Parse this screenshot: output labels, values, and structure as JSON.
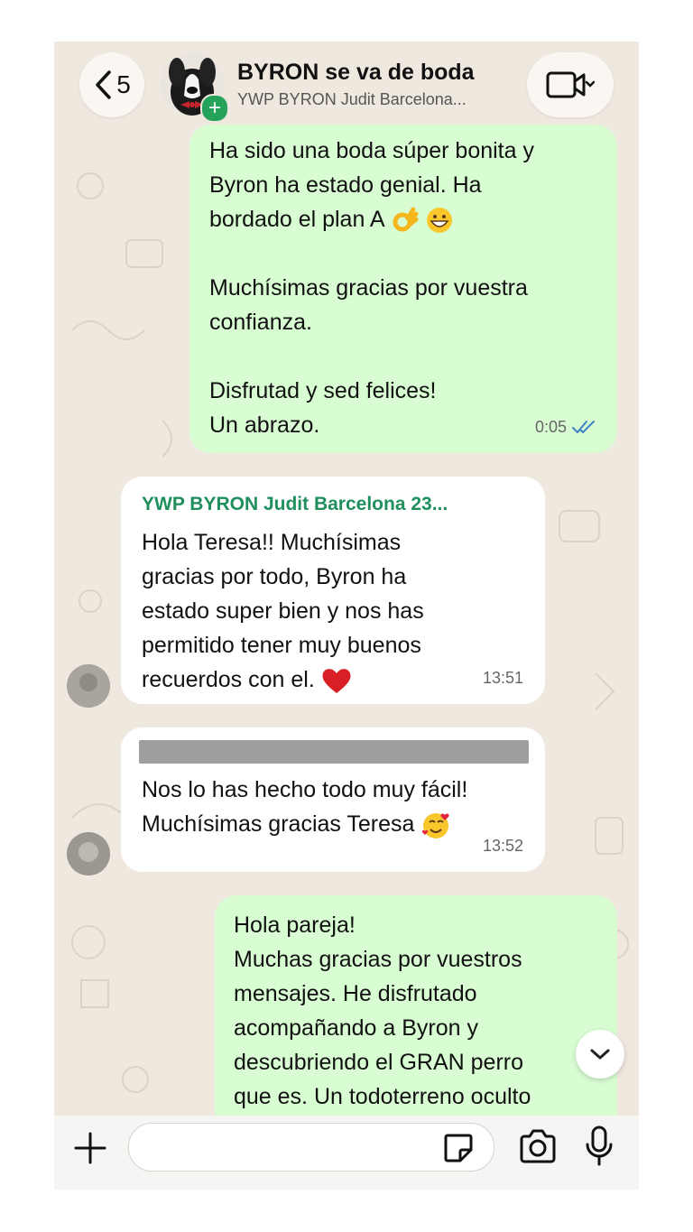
{
  "header": {
    "back_count": "5",
    "title": "BYRON se va de boda",
    "subtitle": "YWP BYRON Judit Barcelona..."
  },
  "messages": {
    "m1": {
      "lines": [
        "Ha sido una boda súper bonita y",
        "Byron ha estado genial. Ha",
        "bordado el plan A"
      ],
      "lines2": [
        "Muchísimas gracias por vuestra",
        "confianza."
      ],
      "lines3": [
        "Disfrutad y sed felices!",
        "Un abrazo."
      ],
      "time": "0:05"
    },
    "m2": {
      "sender": "YWP BYRON Judit Barcelona 23...",
      "lines": [
        "Hola Teresa!! Muchísimas",
        "gracias por todo, Byron ha",
        "estado super bien y nos has",
        "permitido tener muy buenos",
        "recuerdos con el."
      ],
      "time": "13:51"
    },
    "m3": {
      "lines": [
        "Nos lo has hecho todo muy fácil!",
        "Muchísimas gracias Teresa"
      ],
      "time": "13:52"
    },
    "m4": {
      "lines": [
        "Hola pareja!",
        "Muchas gracias por vuestros",
        "mensajes. He disfrutado",
        "acompañando a Byron y",
        "descubriendo el GRAN perro",
        "que es. Un todoterreno oculto"
      ]
    }
  },
  "colors": {
    "outgoing_bubble": "#d9fdd3",
    "incoming_bubble": "#ffffff",
    "sender_name": "#1f8f5d",
    "read_ticks": "#3b82c4",
    "wallpaper": "#efe8df"
  },
  "icons": [
    "back-chevron-icon",
    "video-call-icon",
    "chevron-down-icon",
    "plus-icon",
    "sticker-icon",
    "camera-icon",
    "microphone-icon",
    "double-check-icon",
    "ok-hand-emoji",
    "grinning-emoji",
    "red-heart-emoji",
    "smiling-hearts-emoji"
  ]
}
